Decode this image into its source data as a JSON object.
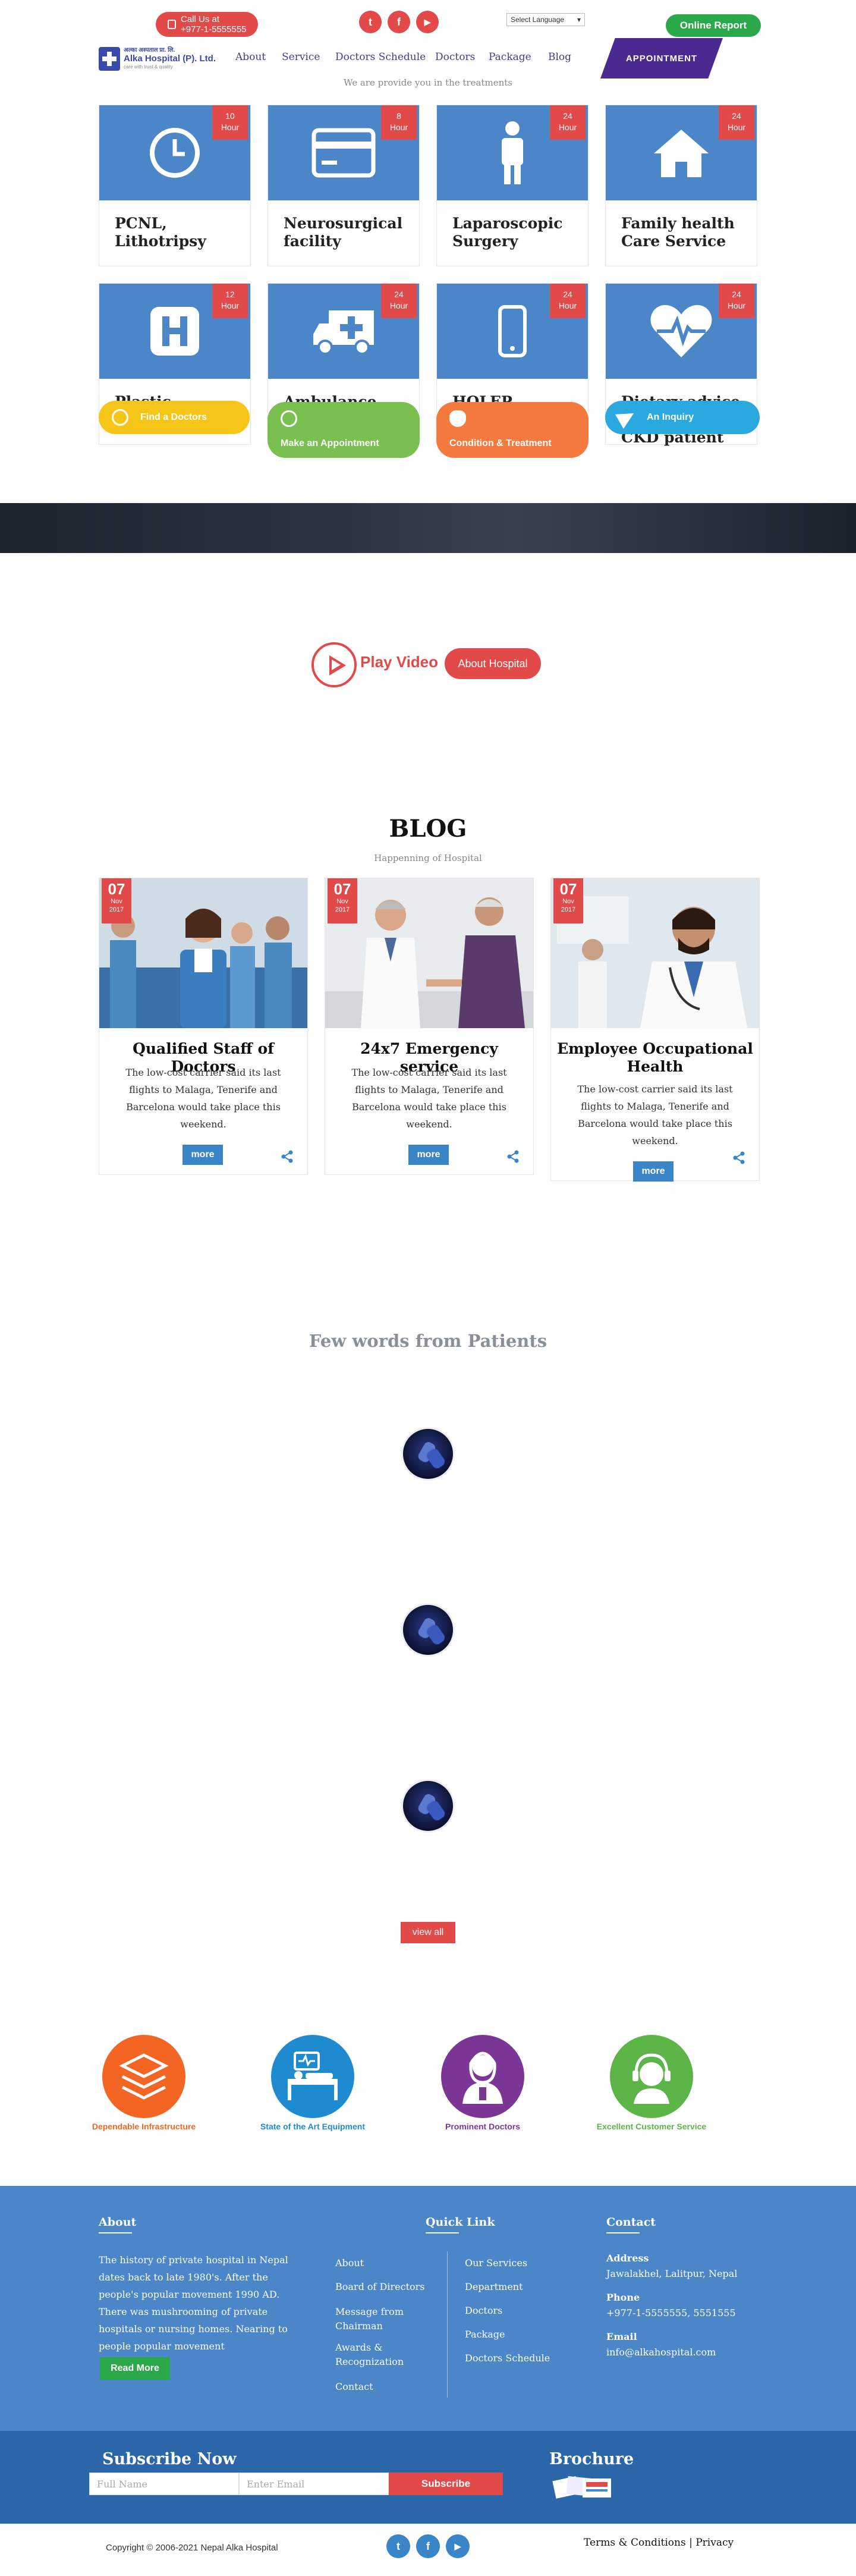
{
  "header": {
    "call_us": "Call Us at",
    "phone": "+977-1-5555555",
    "social": [
      "t",
      "f",
      "▶"
    ],
    "language": "Select Language",
    "online_report": "Online Report",
    "logo_line1": "अल्का अस्पताल प्रा. लि.",
    "logo_line2": "Alka Hospital (P). Ltd.",
    "logo_line3": "care with trust & quality",
    "nav": [
      "About",
      "Service",
      "Doctors Schedule",
      "Doctors",
      "Package",
      "Blog"
    ],
    "appointment": "APPOINTMENT",
    "subtitle": "We are provide you in the treatments"
  },
  "services": [
    {
      "hours": "10",
      "unit": "Hour",
      "title": "PCNL, Lithotripsy",
      "icon": "clock-icon"
    },
    {
      "hours": "8",
      "unit": "Hour",
      "title": "Neurosurgical facility",
      "icon": "credit-card-icon"
    },
    {
      "hours": "24",
      "unit": "Hour",
      "title": "Laparoscopic Surgery",
      "icon": "person-icon"
    },
    {
      "hours": "24",
      "unit": "Hour",
      "title": "Family health Care Service",
      "icon": "home-icon"
    },
    {
      "hours": "12",
      "unit": "Hour",
      "title": "Plastic surgery",
      "icon": "hospital-icon"
    },
    {
      "hours": "24",
      "unit": "Hour",
      "title": "Ambulance Services",
      "icon": "ambulance-icon"
    },
    {
      "hours": "24",
      "unit": "Hour",
      "title": "HOLEP",
      "icon": "phone-icon"
    },
    {
      "hours": "24",
      "unit": "Hour",
      "title": "Dietary advice diabetes and CKD patient",
      "icon": "heartbeat-icon"
    }
  ],
  "quick_links": [
    {
      "label": "Find a Doctors",
      "color": "#f5c518"
    },
    {
      "label": "Make an Appointment",
      "color": "#7ac050"
    },
    {
      "label": "Condition & Treatment",
      "color": "#f47a40"
    },
    {
      "label": "An Inquiry",
      "color": "#2aa8e0"
    }
  ],
  "video": {
    "play": "Play Video",
    "about": "About Hospital"
  },
  "blog": {
    "heading": "BLOG",
    "subheading": "Happenning of Hospital",
    "posts": [
      {
        "day": "07",
        "month": "Nov",
        "year": "2017",
        "title": "Qualified Staff of Doctors",
        "text": "The low-cost carrier said its last flights to Malaga, Tenerife and Barcelona would take place this weekend.",
        "more": "more"
      },
      {
        "day": "07",
        "month": "Nov",
        "year": "2017",
        "title": "24x7 Emergency service",
        "text": "The low-cost carrier said its last flights to Malaga, Tenerife and Barcelona would take place this weekend.",
        "more": "more"
      },
      {
        "day": "07",
        "month": "Nov",
        "year": "2017",
        "title": "Employee Occupational Health",
        "text": "The low-cost carrier said its last flights to Malaga, Tenerife and Barcelona would take place this weekend.",
        "more": "more"
      }
    ]
  },
  "patients": {
    "heading": "Few words from Patients",
    "view_all": "view all"
  },
  "features": [
    {
      "label": "Dependable Infrastructure",
      "color": "#f26522"
    },
    {
      "label": "State of the Art Equipment",
      "color": "#1e8ad0"
    },
    {
      "label": "Prominent Doctors",
      "color": "#7b3696"
    },
    {
      "label": "Excellent Customer Service",
      "color": "#5cb546"
    }
  ],
  "footer": {
    "about_h": "About",
    "about_text": "The history of private hospital in Nepal dates back to late 1980's. After the people's popular movement 1990 AD. There was mushrooming of private hospitals or nursing homes. Nearing to people popular movement",
    "read_more": "Read More",
    "quick_h": "Quick Link",
    "links_left": [
      "About",
      "Board of Directors",
      "Message from Chairman",
      "Awards & Recognization",
      "Contact"
    ],
    "links_right": [
      "Our Services",
      "Department",
      "Doctors",
      "Package",
      "Doctors Schedule"
    ],
    "contact_h": "Contact",
    "address_l": "Address",
    "address": "Jawalakhel, Lalitpur, Nepal",
    "phone_l": "Phone",
    "phone": "+977-1-5555555, 5551555",
    "email_l": "Email",
    "email": "info@alkahospital.com"
  },
  "subscribe": {
    "heading": "Subscribe Now",
    "name_placeholder": "Full Name",
    "email_placeholder": "Enter Email",
    "button": "Subscribe",
    "brochure": "Brochure"
  },
  "bottom": {
    "copyright": "Copyright © 2006-2021 Nepal Alka Hospital",
    "social": [
      "t",
      "f",
      "▶"
    ],
    "terms": "Terms & Conditions | Privacy"
  }
}
